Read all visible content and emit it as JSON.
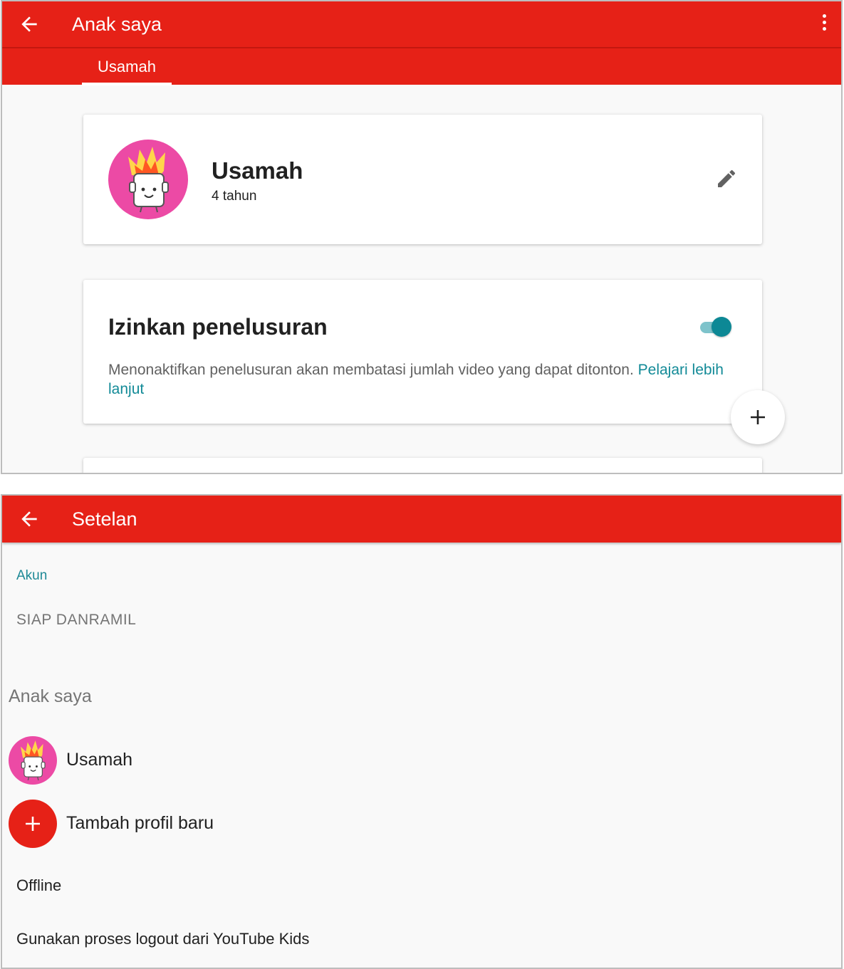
{
  "screen_top": {
    "title": "Anak saya",
    "tab": "Usamah",
    "profile": {
      "name": "Usamah",
      "age": "4 tahun"
    },
    "search_card": {
      "title": "Izinkan penelusuran",
      "toggle_on": true,
      "description": "Menonaktifkan penelusuran akan membatasi jumlah video yang dapat ditonton.",
      "link": "Pelajari lebih lanjut"
    }
  },
  "screen_bottom": {
    "title": "Setelan",
    "account_label": "Akun",
    "account_name": "SIAP DANRAMIL",
    "children_label": "Anak saya",
    "child_name": "Usamah",
    "add_profile": "Tambah profil baru",
    "offline": "Offline",
    "logout": "Gunakan proses logout dari YouTube Kids"
  },
  "colors": {
    "appbar": "#e62117",
    "accent": "#128a97",
    "avatar_bg": "#ec4aa5"
  },
  "icons": [
    "back-arrow-icon",
    "more-vert-icon",
    "edit-pencil-icon",
    "plus-icon"
  ]
}
